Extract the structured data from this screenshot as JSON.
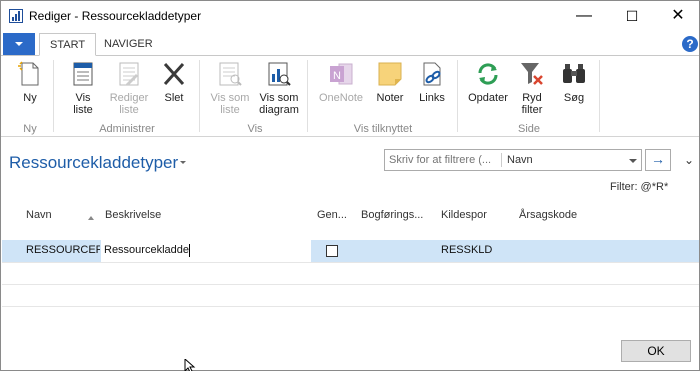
{
  "window": {
    "title": "Rediger - Ressourcekladdetyper",
    "minimize": "—",
    "maximize": "☐",
    "close": "✕"
  },
  "ribbon_tabs": [
    "START",
    "NAVIGER"
  ],
  "help": "?",
  "ribbon": {
    "buttons": [
      {
        "label": "Ny",
        "icon": "new-document-icon",
        "enabled": true
      },
      {
        "label": "Vis\nliste",
        "icon": "view-list-icon",
        "enabled": true
      },
      {
        "label": "Rediger\nliste",
        "icon": "edit-list-icon",
        "enabled": false
      },
      {
        "label": "Slet",
        "icon": "delete-icon",
        "enabled": true
      },
      {
        "label": "Vis som\nliste",
        "icon": "view-as-list-icon",
        "enabled": false
      },
      {
        "label": "Vis som\ndiagram",
        "icon": "view-as-chart-icon",
        "enabled": true
      },
      {
        "label": "OneNote",
        "icon": "onenote-icon",
        "enabled": false
      },
      {
        "label": "Noter",
        "icon": "notes-icon",
        "enabled": true
      },
      {
        "label": "Links",
        "icon": "links-icon",
        "enabled": true
      },
      {
        "label": "Opdater",
        "icon": "refresh-icon",
        "enabled": true
      },
      {
        "label": "Ryd\nfilter",
        "icon": "clear-filter-icon",
        "enabled": true
      },
      {
        "label": "Søg",
        "icon": "binoculars-icon",
        "enabled": true
      }
    ],
    "groups": [
      "Ny",
      "Administrer",
      "Vis",
      "Vis tilknyttet",
      "Side"
    ]
  },
  "page": {
    "title": "Ressourcekladdetyper",
    "filter_placeholder": "Skriv for at filtrere (...",
    "filter_field": "Navn",
    "filter_go": "→",
    "collapse": "⌄",
    "filter_status": "Filter: @*R*"
  },
  "table": {
    "columns": [
      "Navn",
      "Beskrivelse",
      "Gen...",
      "Bogførings...",
      "Kildespor",
      "Årsagskode"
    ],
    "rows": [
      {
        "navn": "RESSOURCER",
        "beskrivelse": "Ressourcekladde",
        "gen": false,
        "bogforing": "",
        "kildespor": "RESSKLD",
        "arsagskode": ""
      }
    ]
  },
  "footer": {
    "ok": "OK"
  },
  "colors": {
    "accent": "#1e5da8",
    "file_button": "#2b6ac8",
    "selected_row": "#cfe4f7",
    "refresh": "#2e9e55",
    "delete": "#3a3a3a"
  }
}
